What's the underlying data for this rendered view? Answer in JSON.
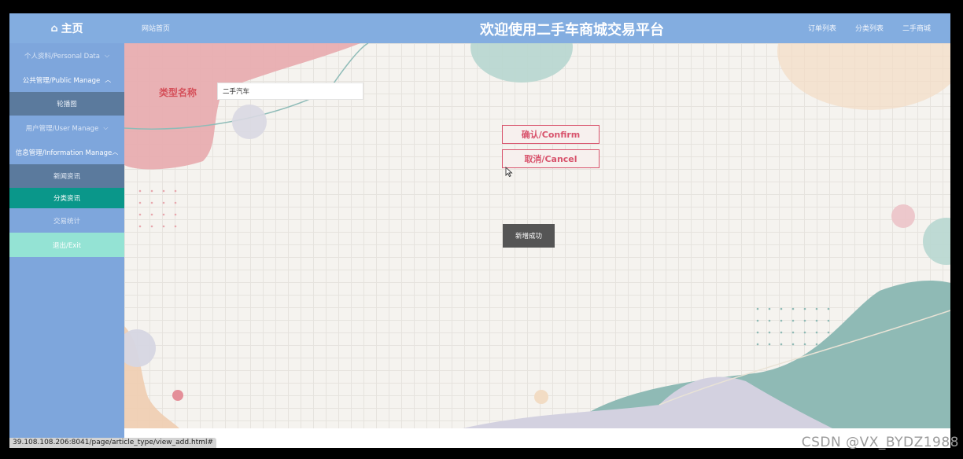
{
  "header": {
    "home_label": "主页",
    "site_home_label": "网站首页",
    "title": "欢迎使用二手车商城交易平台",
    "nav": [
      "订单列表",
      "分类列表",
      "二手商城"
    ]
  },
  "sidebar": {
    "items": [
      {
        "label": "个人资料/Personal Data"
      },
      {
        "label": "公共管理/Public Manage"
      },
      {
        "label": "轮播图"
      },
      {
        "label": "用户管理/User Manage"
      },
      {
        "label": "信息管理/Information Manage"
      },
      {
        "label": "新闻资讯"
      },
      {
        "label": "分类资讯"
      },
      {
        "label": "交易统计"
      },
      {
        "label": "退出/Exit"
      }
    ]
  },
  "form": {
    "type_label": "类型名称",
    "type_value": "二手汽车"
  },
  "buttons": {
    "confirm": "确认/Confirm",
    "cancel": "取消/Cancel"
  },
  "toast": "新增成功",
  "status_url": "39.108.108.206:8041/page/article_type/view_add.html#",
  "watermark": "CSDN @VX_BYDZ1988",
  "colors": {
    "header": "#83ade0",
    "sidebar": "#7ea6dc",
    "active": "#0a978a",
    "accent": "#d8536c"
  }
}
